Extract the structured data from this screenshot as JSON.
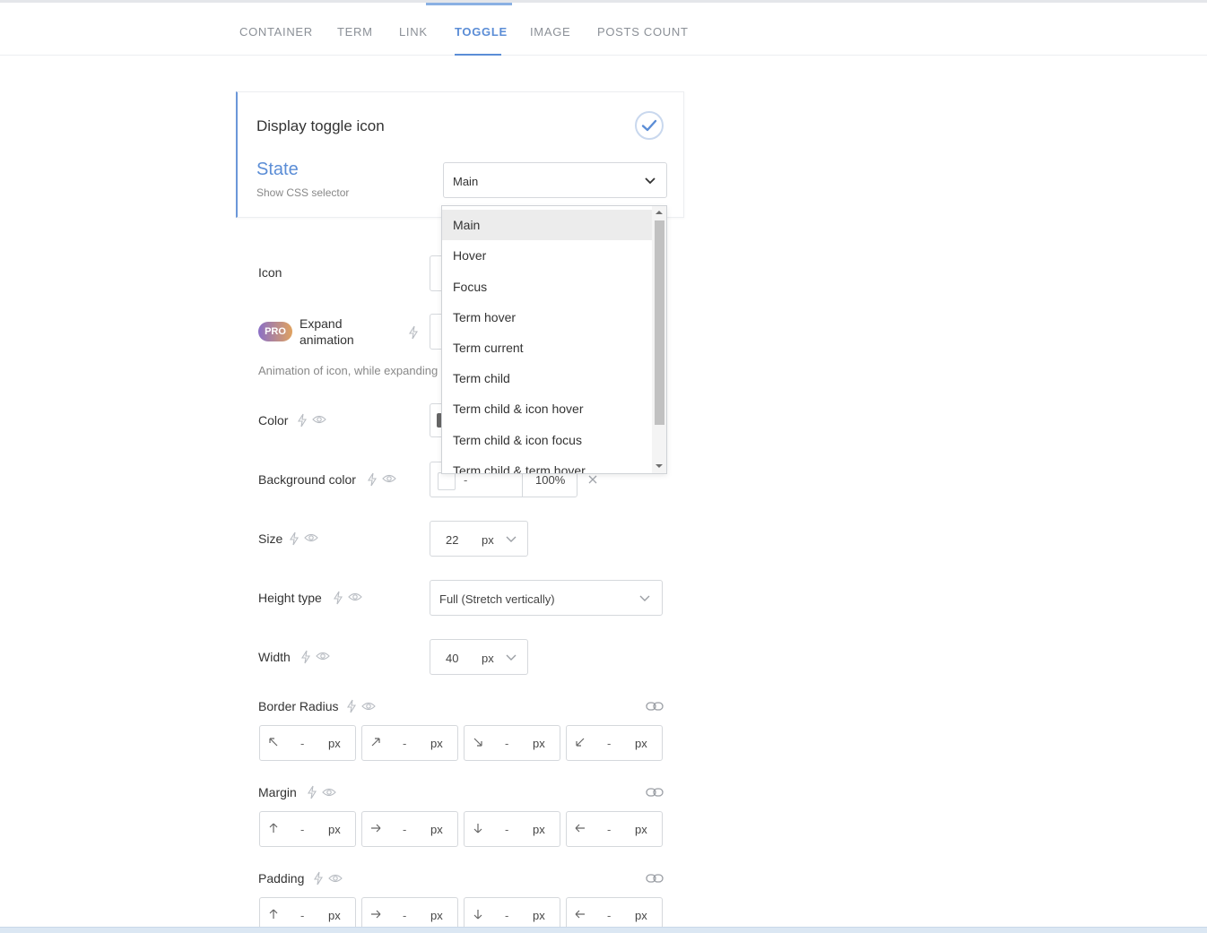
{
  "tabs": [
    "CONTAINER",
    "TERM",
    "LINK",
    "TOGGLE",
    "IMAGE",
    "POSTS COUNT"
  ],
  "active_tab": "TOGGLE",
  "card": {
    "title": "Display toggle icon",
    "state_label": "State",
    "state_sub": "Show CSS selector",
    "state_value": "Main"
  },
  "dropdown": {
    "options": [
      "Main",
      "Hover",
      "Focus",
      "Term hover",
      "Term current",
      "Term child",
      "Term child & icon hover",
      "Term child & icon focus",
      "Term child & term hover"
    ],
    "selected": "Main"
  },
  "fields": {
    "icon_label": "Icon",
    "pro_badge": "PRO",
    "expand_label_1": "Expand",
    "expand_label_2": "animation",
    "expand_help": "Animation of icon, while expanding",
    "color_label": "Color",
    "bg_color_label": "Background color",
    "bg_color_value": "-",
    "bg_color_opacity": "100%",
    "size_label": "Size",
    "size_value": "22",
    "size_unit": "px",
    "height_type_label": "Height type",
    "height_type_value": "Full (Stretch vertically)",
    "width_label": "Width",
    "width_value": "40",
    "width_unit": "px",
    "border_radius_label": "Border Radius",
    "margin_label": "Margin",
    "padding_label": "Padding",
    "dash": "-",
    "unit": "px"
  },
  "colors": {
    "accent": "#5b8dd6",
    "text": "#333333",
    "muted": "#888888",
    "border": "#d5d8dc"
  }
}
